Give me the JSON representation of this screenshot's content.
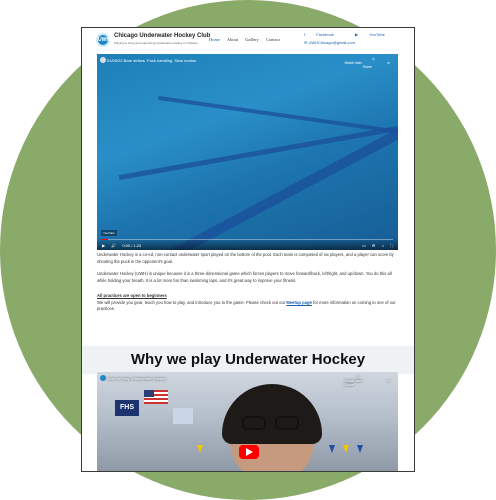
{
  "header": {
    "brand": "Chicago Underwater Hockey Club",
    "tagline": "Playing to bring and supporting Underwater Hockey in Chicago",
    "nav": [
      "Home",
      "About",
      "Gallery",
      "Contact"
    ],
    "facebook": "Facebook",
    "youtube": "YouTube",
    "email": "UWHChicago@gmail.com"
  },
  "video1": {
    "title": "01/09/22 Bare strikes. Puck handling. Slow motion.",
    "watch_later": "Watch later",
    "share": "Share",
    "time": "0:00 / 1:23",
    "progress": 0.02
  },
  "body": {
    "p1": "Underwater Hockey is a co-ed, non-contact underwater sport played on the bottom of the pool. Each team is composed of six players, and a player can score by shooting the puck in the opponent's goal.",
    "p2": "Underwater Hockey (UWH) is unique because it is a three-dimensional game which forces players to move forward/back, left/right, and up/down. You do this all while holding your breath. It is a lot more fun than swimming laps, and it's great way to improve your fitness.",
    "practice_heading": "All practices are open to beginners",
    "p3_before": "We will provide you gear, teach you how to play, and introduce you to the game. Please check out our ",
    "p3_link": "Meetup page",
    "p3_after": " for more information on coming to one of our practices."
  },
  "why": {
    "heading": "Why we play Underwater Hockey"
  },
  "video2": {
    "title": "Why we play Underwater Hockey",
    "watch_later": "Watch later",
    "share": "Share",
    "banner": "FHS"
  }
}
